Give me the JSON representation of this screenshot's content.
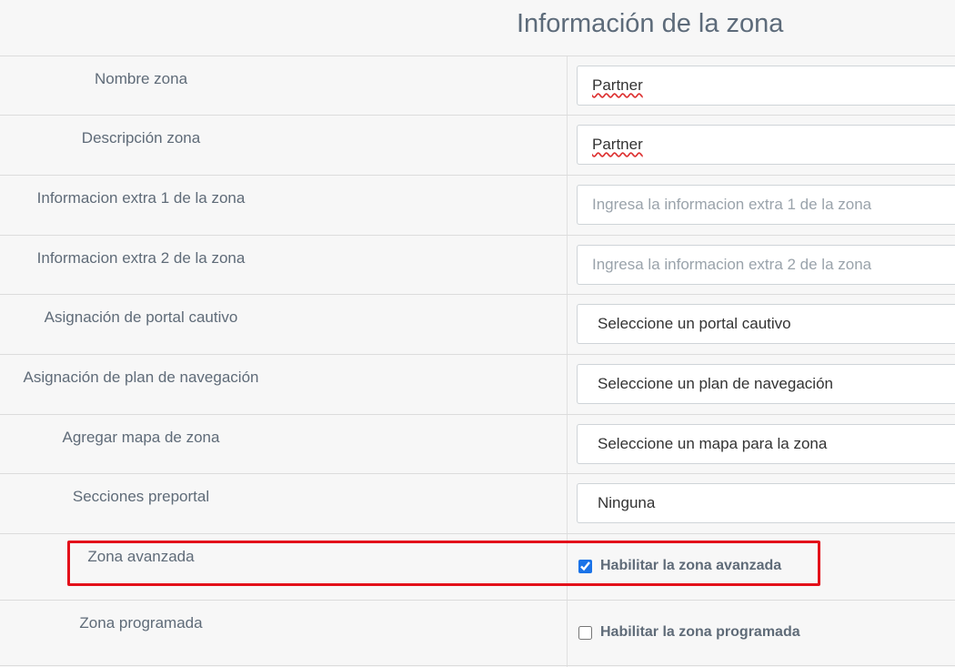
{
  "page": {
    "title": "Información de la zona"
  },
  "fields": {
    "nombre": {
      "label": "Nombre zona",
      "value": "Partner"
    },
    "descripcion": {
      "label": "Descripción zona",
      "value": "Partner"
    },
    "extra1": {
      "label": "Informacion extra 1 de la zona",
      "placeholder": "Ingresa la informacion extra 1 de la zona"
    },
    "extra2": {
      "label": "Informacion extra 2 de la zona",
      "placeholder": "Ingresa la informacion extra 2 de la zona"
    },
    "portal": {
      "label": "Asignación de portal cautivo",
      "selected": "Seleccione un portal cautivo"
    },
    "plan": {
      "label": "Asignación de plan de navegación",
      "selected": "Seleccione un plan de navegación"
    },
    "mapa": {
      "label": "Agregar mapa de zona",
      "selected": "Seleccione un mapa para la zona"
    },
    "secciones": {
      "label": "Secciones preportal",
      "selected": "Ninguna"
    },
    "avanzada": {
      "label": "Zona avanzada",
      "checkbox_label": "Habilitar la zona avanzada",
      "checked": true
    },
    "programada": {
      "label": "Zona programada",
      "checkbox_label": "Habilitar la zona programada",
      "checked": false
    }
  },
  "colors": {
    "highlight": "#e3101a",
    "checkbox_accent": "#1a73e8"
  }
}
